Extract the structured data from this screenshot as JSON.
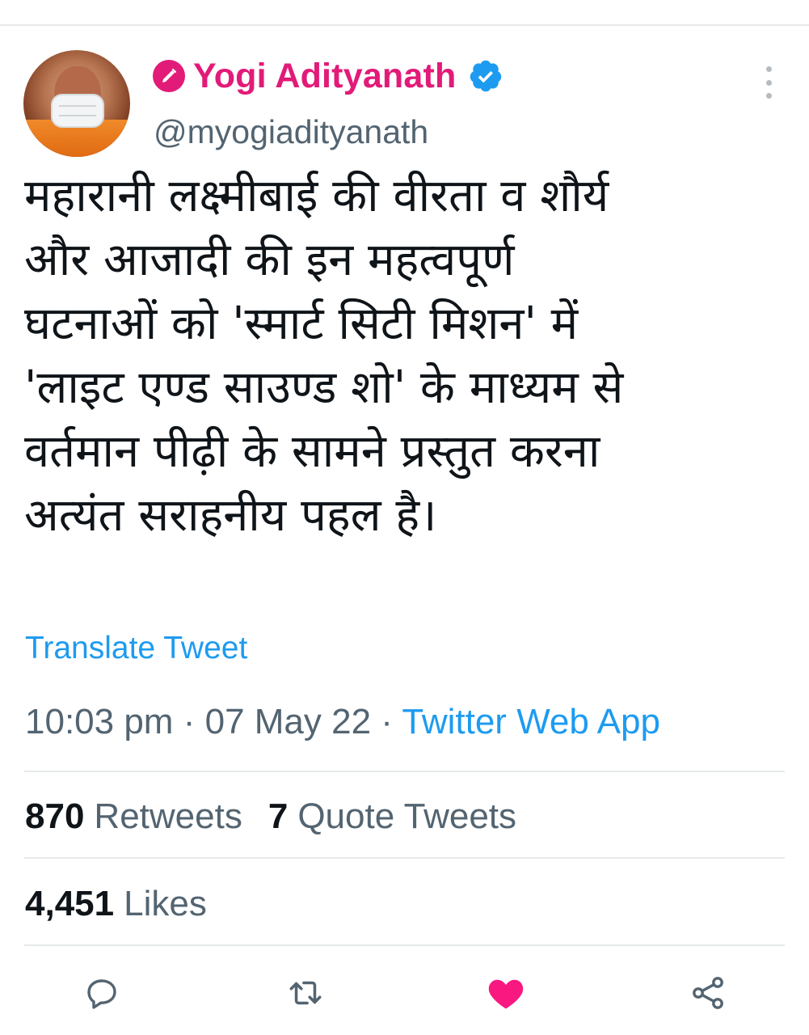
{
  "author": {
    "display_name": "Yogi Adityanath",
    "handle": "@myogiadityanath",
    "avatar_icon": "profile-photo",
    "badge_icon": "party-badge-icon",
    "verified_icon": "verified-badge-icon"
  },
  "tweet": {
    "lines": [
      "महारानी लक्ष्मीबाई की वीरता व शौर्य",
      "और आजादी की इन महत्वपूर्ण",
      "घटनाओं को 'स्मार्ट सिटी मिशन' में",
      "'लाइट एण्ड साउण्ड शो' के माध्यम से",
      "वर्तमान पीढ़ी के सामने प्रस्तुत करना",
      "अत्यंत सराहनीय पहल है।"
    ],
    "translate_label": "Translate Tweet"
  },
  "meta": {
    "time": "10:03 pm",
    "separator": "·",
    "date": "07 May 22",
    "source": "Twitter Web App"
  },
  "stats": {
    "retweets_count": "870",
    "retweets_label": "Retweets",
    "quotes_count": "7",
    "quotes_label": "Quote Tweets",
    "likes_count": "4,451",
    "likes_label": "Likes"
  },
  "actions": [
    {
      "icon": "reply-icon",
      "liked": false
    },
    {
      "icon": "retweet-icon",
      "liked": false
    },
    {
      "icon": "heart-icon",
      "liked": true
    },
    {
      "icon": "share-icon",
      "liked": false
    }
  ],
  "colors": {
    "name": "#e21a78",
    "link": "#1d9bf0",
    "secondary_text": "#536471",
    "like": "#f91880",
    "verified": "#1d9bf0"
  }
}
